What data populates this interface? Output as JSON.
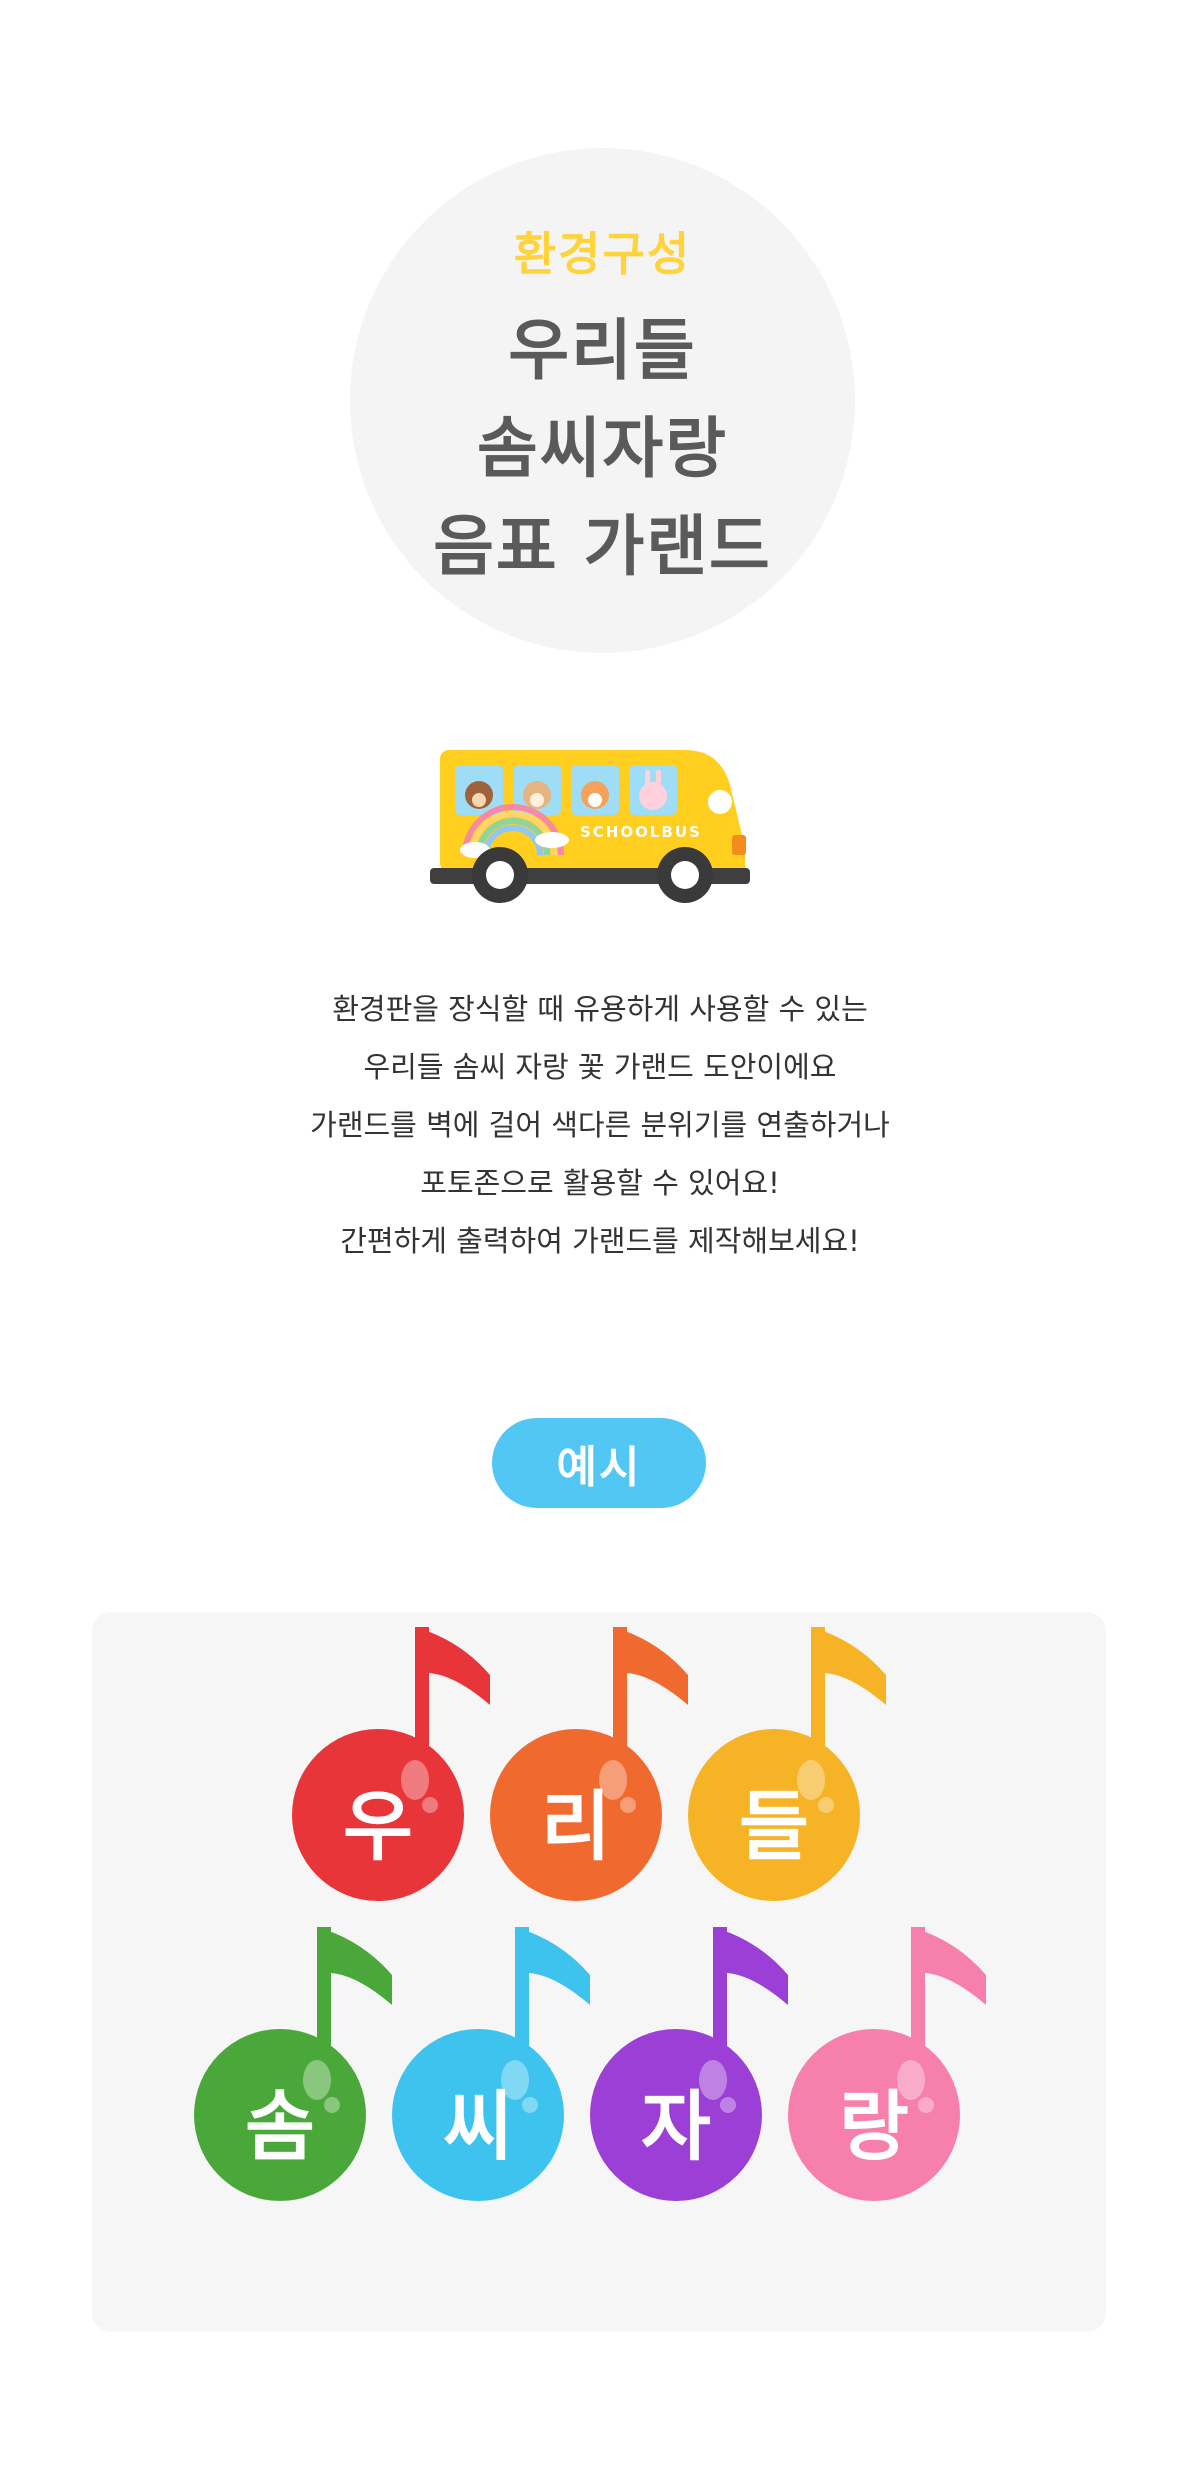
{
  "hero": {
    "kicker": "환경구성",
    "title_lines": [
      "우리들",
      "솜씨자랑",
      "음표 가랜드"
    ]
  },
  "illustration": {
    "bus_text": "SCHOOLBUS",
    "bus_color": "#ffce1f"
  },
  "description": {
    "lines": [
      "환경판을 장식할 때 유용하게 사용할 수 있는",
      "우리들 솜씨 자랑 꽃 가랜드 도안이에요",
      "가랜드를 벽에 걸어 색다른 분위기를 연출하거나",
      "포토존으로 활용할 수 있어요!",
      "간편하게 출력하여 가랜드를 제작해보세요!"
    ]
  },
  "example": {
    "label": "예시"
  },
  "garland": {
    "row1": [
      {
        "char": "우",
        "color": "#e8353a"
      },
      {
        "char": "리",
        "color": "#f06a30"
      },
      {
        "char": "들",
        "color": "#f5b325"
      }
    ],
    "row2": [
      {
        "char": "솜",
        "color": "#4aa83a"
      },
      {
        "char": "씨",
        "color": "#3ec3ef"
      },
      {
        "char": "자",
        "color": "#9b3fd6"
      },
      {
        "char": "랑",
        "color": "#f680ab"
      }
    ]
  }
}
